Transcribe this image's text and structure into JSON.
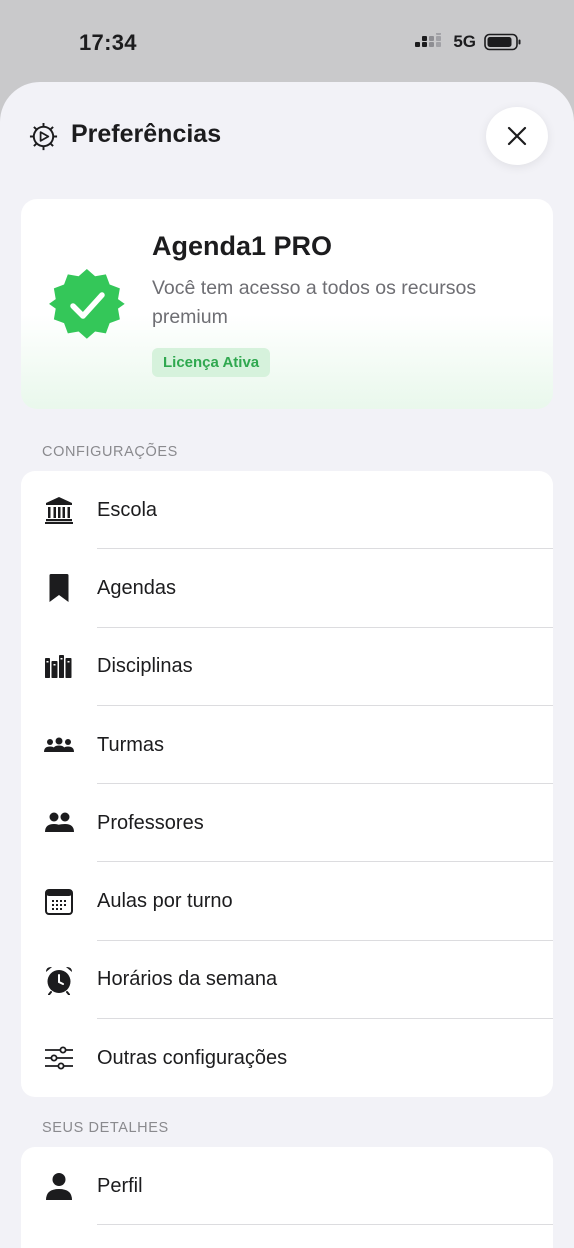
{
  "status_bar": {
    "time": "17:34",
    "network": "5G"
  },
  "header": {
    "title": "Preferências"
  },
  "pro_card": {
    "title": "Agenda1 PRO",
    "description": "Você tem acesso a todos os recursos premium",
    "badge": "Licença Ativa"
  },
  "sections": {
    "config_label": "CONFIGURAÇÕES",
    "details_label": "SEUS DETALHES"
  },
  "config_items": [
    {
      "label": "Escola",
      "icon": "building-columns-icon"
    },
    {
      "label": "Agendas",
      "icon": "bookmark-icon"
    },
    {
      "label": "Disciplinas",
      "icon": "books-icon"
    },
    {
      "label": "Turmas",
      "icon": "group-three-icon"
    },
    {
      "label": "Professores",
      "icon": "group-two-icon"
    },
    {
      "label": "Aulas por turno",
      "icon": "calendar-icon"
    },
    {
      "label": "Horários da semana",
      "icon": "alarm-clock-icon"
    },
    {
      "label": "Outras configurações",
      "icon": "sliders-icon"
    }
  ],
  "detail_items": [
    {
      "label": "Perfil",
      "icon": "person-icon"
    }
  ],
  "colors": {
    "accent_green": "#34c759",
    "background": "#f2f2f7"
  }
}
